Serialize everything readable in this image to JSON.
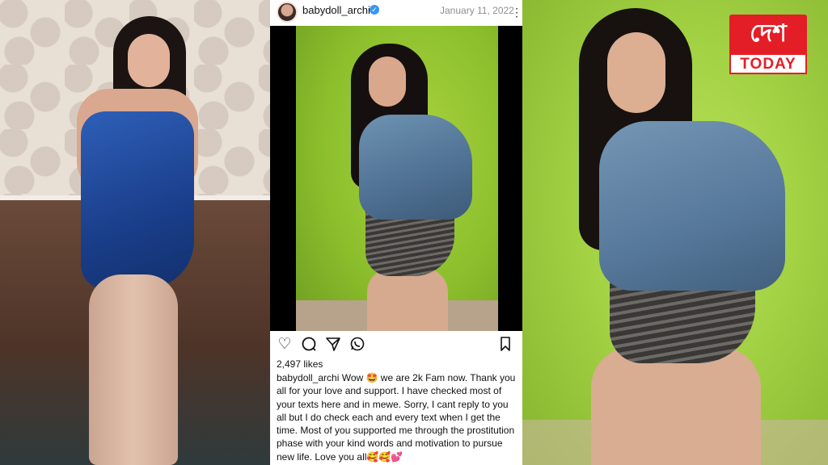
{
  "post": {
    "username": "babydoll_archi",
    "date": "January 11, 2022",
    "likes": "2,497 likes",
    "caption_user": "babydoll_archi",
    "caption_text": "Wow 🤩 we are 2k Fam now. Thank you all for your love and support. I have checked most of your texts here and in mewe. Sorry, I cant reply to you all but I do check each and every text when I get the time. Most of you supported me through the prostitution phase with your kind words and motivation to pursue new life. Love you all🥰🥰💕"
  },
  "icons": {
    "verified": "verified-badge-icon",
    "more": "more-options-icon",
    "like": "heart-icon",
    "comment": "comment-icon",
    "share": "send-icon",
    "whatsapp": "whatsapp-icon",
    "save": "bookmark-icon"
  },
  "logo": {
    "bengali": "দেশ",
    "english": "TODAY"
  },
  "colors": {
    "logo_red": "#e41e26",
    "verified_blue": "#3897f0",
    "text": "#111111",
    "muted": "#8e8e8e"
  }
}
